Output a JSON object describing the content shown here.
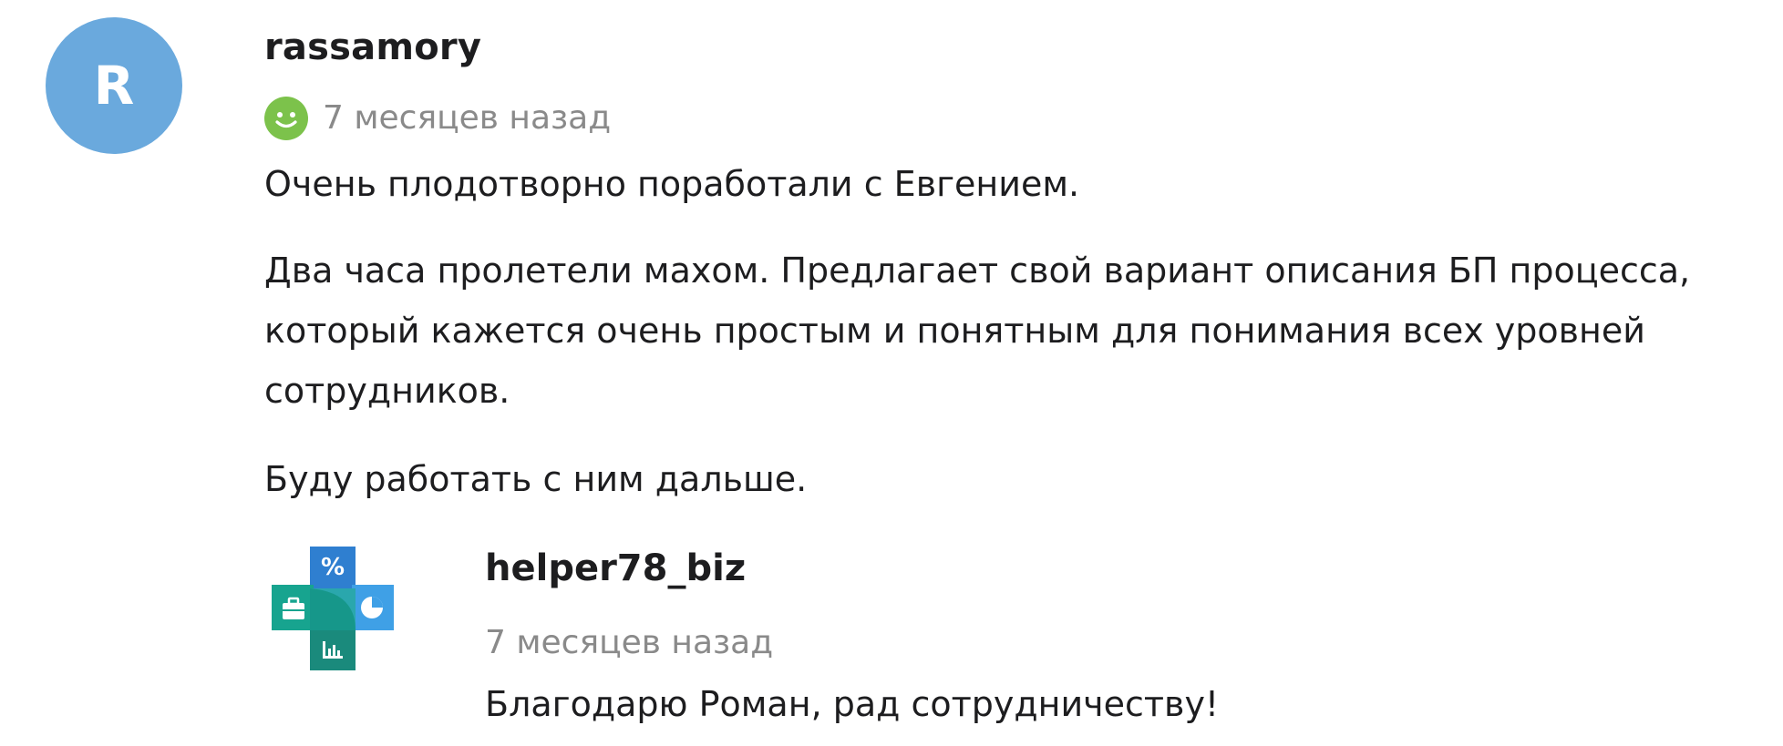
{
  "review": {
    "avatar_letter": "R",
    "avatar_color": "#6aa9dd",
    "username": "rassamory",
    "rating_icon": "smile-icon",
    "rating_color": "#7cc24b",
    "time": "7 месяцев назад",
    "paragraphs": [
      "Очень плодотворно поработали с Евгением.",
      "Два часа пролетели махом. Предлагает свой вариант описания БП процесса, который кажется очень простым и понятным для понимания всех уровней сотрудников.",
      "Буду работать с ним дальше."
    ]
  },
  "reply": {
    "logo_icon": "business-plus-logo",
    "logo_glyph_top": "%",
    "username": "helper78_biz",
    "time": "7 месяцев назад",
    "text": "Благодарю Роман, рад сотрудничеству!"
  }
}
